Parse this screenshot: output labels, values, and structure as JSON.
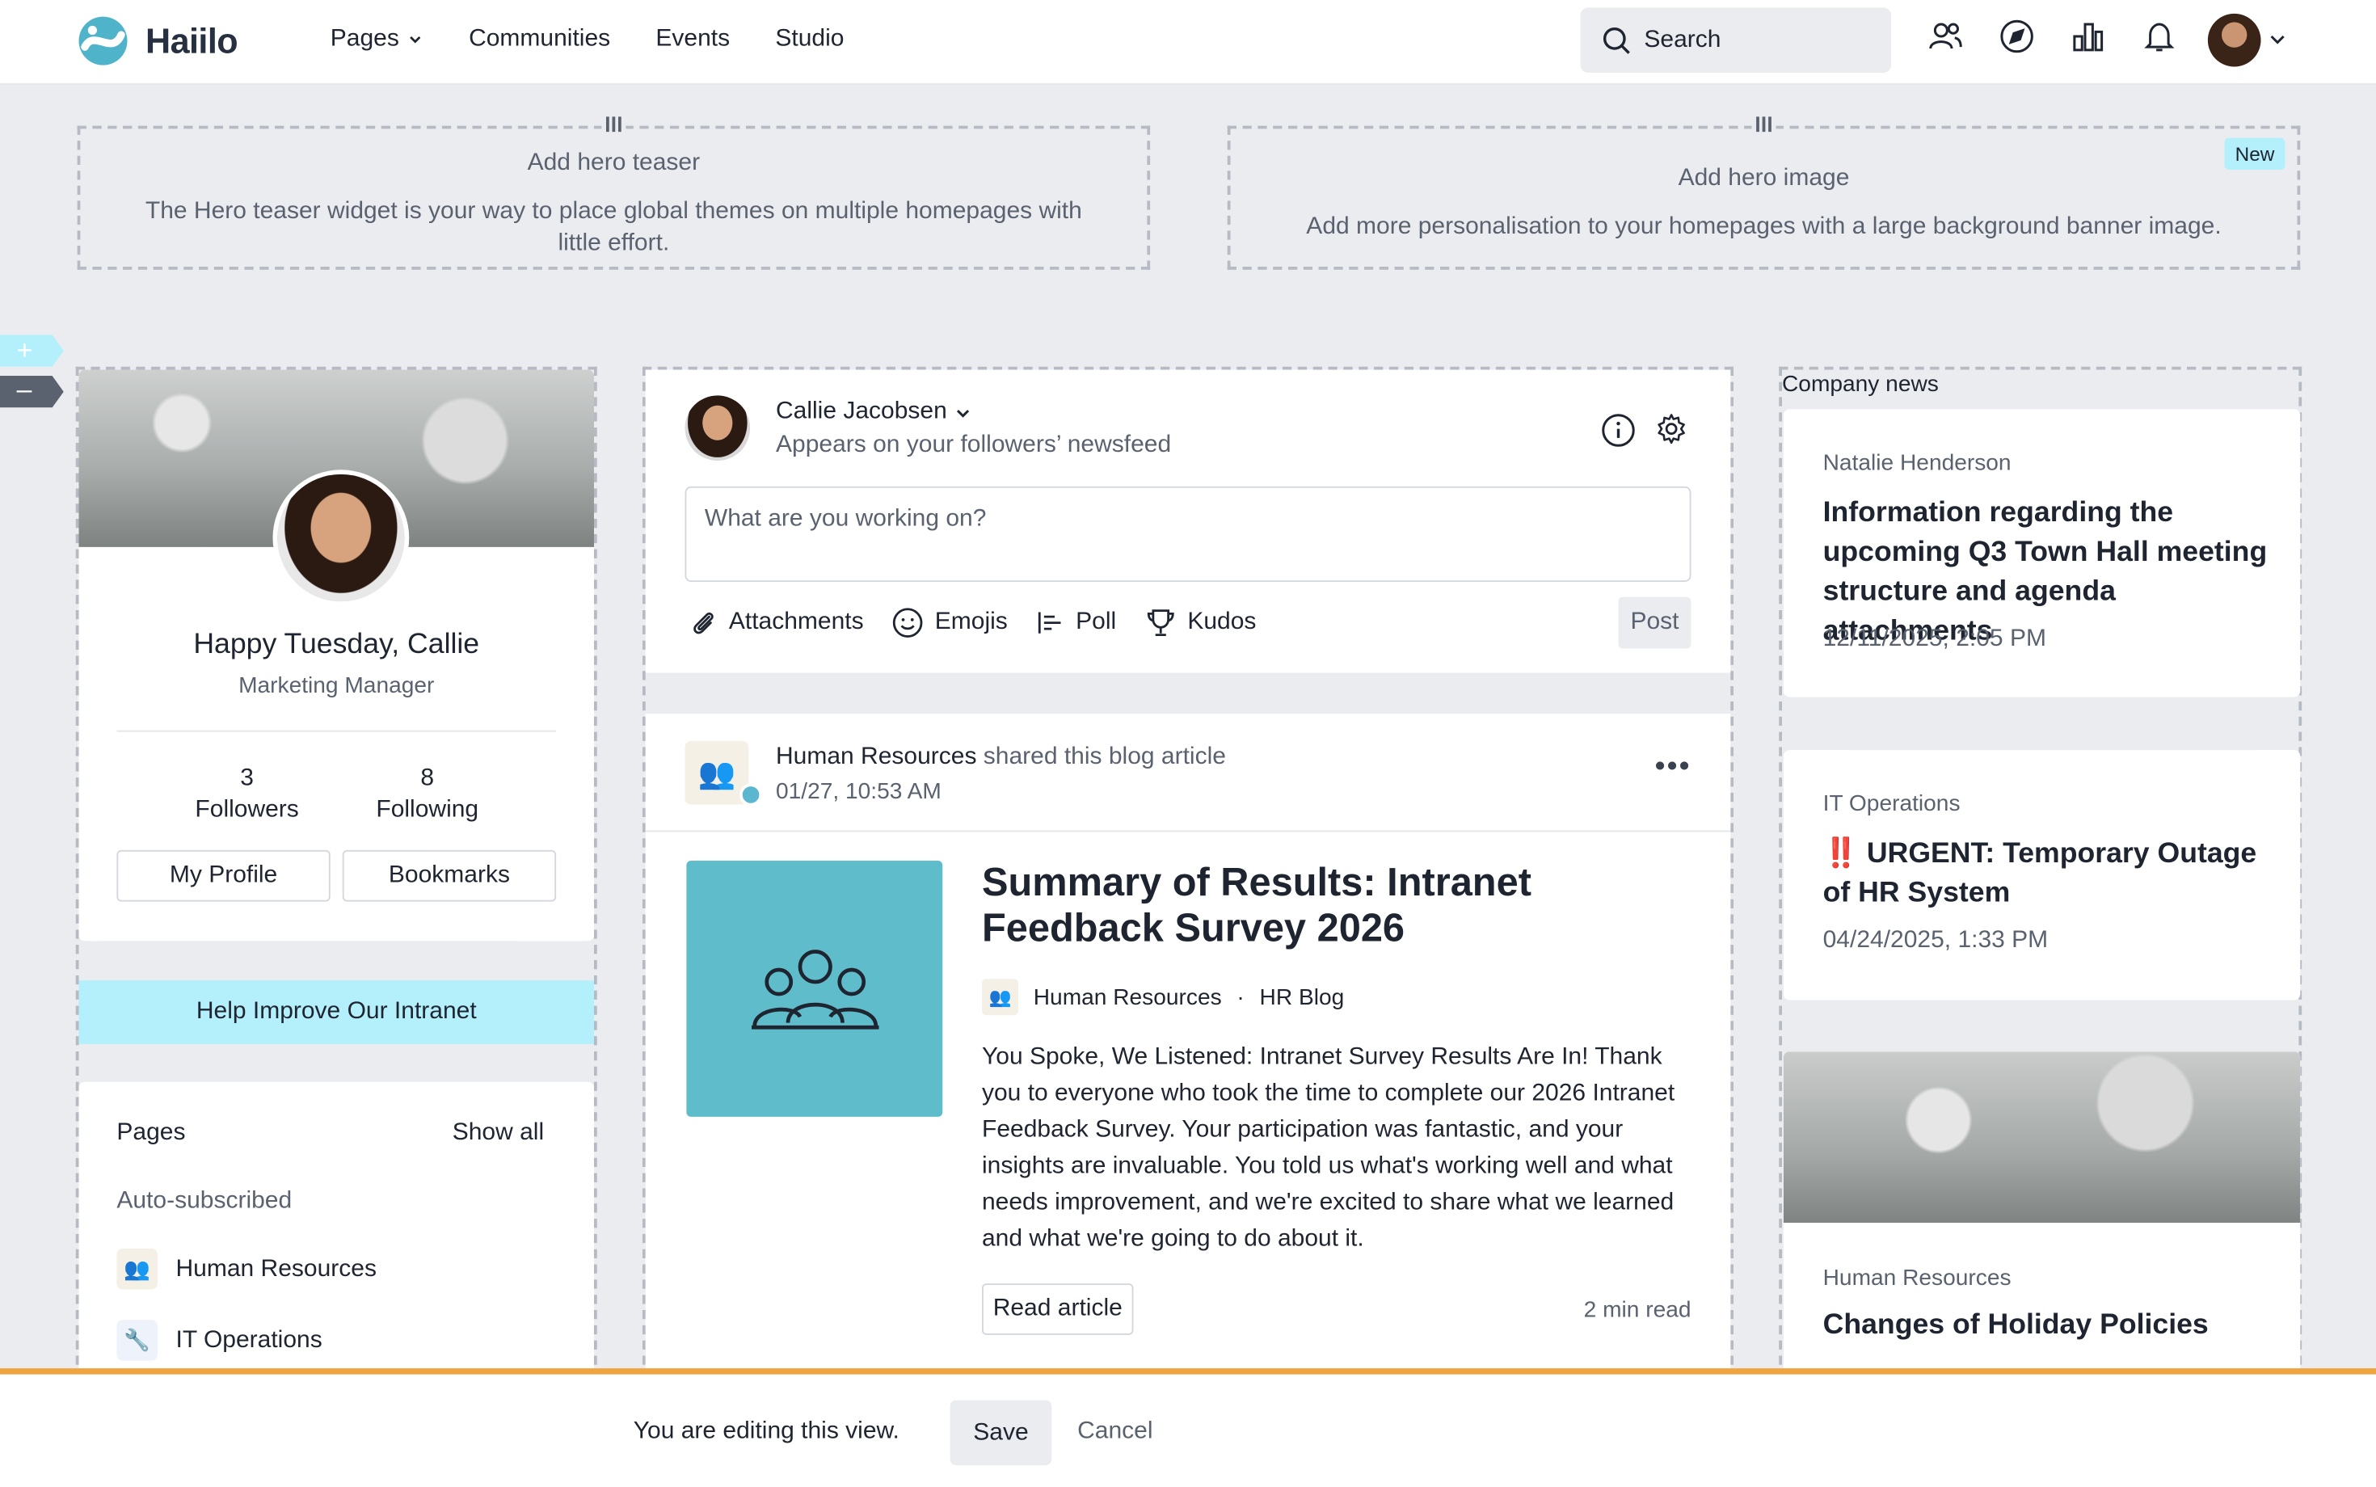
{
  "brand": {
    "name": "Haiilo",
    "accent": "#4fb3c9"
  },
  "nav": {
    "items": [
      {
        "label": "Pages",
        "has_menu": true
      },
      {
        "label": "Communities"
      },
      {
        "label": "Events"
      },
      {
        "label": "Studio"
      }
    ],
    "search_placeholder": "Search",
    "icons": [
      "people-icon",
      "compass-icon",
      "chart-icon",
      "bell-icon"
    ]
  },
  "hero_teaser": {
    "title": "Add hero teaser",
    "description": "The Hero teaser widget is your way to place global themes on multiple homepages with little effort."
  },
  "hero_image": {
    "title": "Add hero image",
    "description": "Add more personalisation to your homepages with a large background banner image.",
    "badge": "New"
  },
  "profile": {
    "greeting": "Happy Tuesday, Callie",
    "role": "Marketing Manager",
    "followers_count": "3",
    "followers_label": "Followers",
    "following_count": "8",
    "following_label": "Following",
    "my_profile": "My Profile",
    "bookmarks": "Bookmarks"
  },
  "help_banner": "Help Improve Our Intranet",
  "pages_widget": {
    "title": "Pages",
    "show_all": "Show all",
    "subtitle": "Auto-subscribed",
    "items": [
      {
        "label": "Human Resources",
        "icon": "hr-icon"
      },
      {
        "label": "IT Operations",
        "icon": "it-icon"
      }
    ]
  },
  "composer": {
    "author": "Callie Jacobsen",
    "visibility": "Appears on your followers’ newsfeed",
    "placeholder": "What are you working on?",
    "tools": {
      "attachments": "Attachments",
      "emojis": "Emojis",
      "poll": "Poll",
      "kudos": "Kudos"
    },
    "post": "Post"
  },
  "post": {
    "sender": "Human Resources",
    "action": "shared this blog article",
    "timestamp": "01/27, 10:53 AM",
    "title": "Summary of Results: Intranet Feedback Survey 2026",
    "meta_author": "Human Resources",
    "meta_separator": "·",
    "meta_blog": "HR Blog",
    "body": "You Spoke, We Listened: Intranet Survey Results Are In! Thank you to everyone who took the time to complete our 2026 Intranet Feedback Survey. Your participation was fantastic, and your insights are invaluable. You told us what's working well and what needs improvement, and we're excited to share what we learned and what we're going to do about it.",
    "read_article": "Read article",
    "read_time": "2 min read",
    "thumb_color": "#5fbccb"
  },
  "company_news": {
    "title": "Company news",
    "items": [
      {
        "author": "Natalie Henderson",
        "headline": "Information regarding the upcoming Q3 Town Hall meeting structure and agenda attachments",
        "date": "12/11/2025, 2:05 PM"
      },
      {
        "author": "IT Operations",
        "headline": "‼️ URGENT: Temporary Outage of HR System",
        "date": "04/24/2025, 1:33 PM"
      },
      {
        "author": "Human Resources",
        "headline": "Changes of Holiday Policies",
        "date": ""
      }
    ]
  },
  "edit_bar": {
    "message": "You are editing this view.",
    "save": "Save",
    "cancel": "Cancel",
    "accent": "#f0a440"
  }
}
